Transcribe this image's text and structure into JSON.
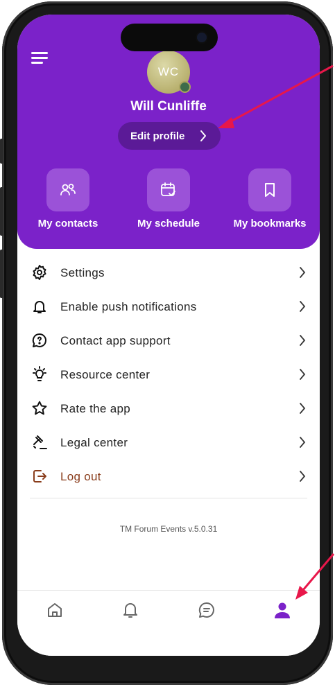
{
  "profile": {
    "initials": "WC",
    "name": "Will Cunliffe",
    "edit_label": "Edit profile"
  },
  "quick_actions": [
    {
      "label": "My contacts",
      "icon": "contacts-icon"
    },
    {
      "label": "My schedule",
      "icon": "calendar-check-icon"
    },
    {
      "label": "My bookmarks",
      "icon": "bookmark-icon"
    }
  ],
  "menu": [
    {
      "label": "Settings",
      "icon": "gear-icon"
    },
    {
      "label": "Enable push notifications",
      "icon": "bell-icon"
    },
    {
      "label": "Contact app support",
      "icon": "help-chat-icon"
    },
    {
      "label": "Resource center",
      "icon": "lightbulb-icon"
    },
    {
      "label": "Rate the app",
      "icon": "star-icon"
    },
    {
      "label": "Legal center",
      "icon": "gavel-icon"
    },
    {
      "label": "Log out",
      "icon": "logout-icon"
    }
  ],
  "version": "TM Forum Events v.5.0.31",
  "tabs": [
    {
      "name": "home",
      "icon": "home-icon",
      "active": false
    },
    {
      "name": "notifications",
      "icon": "bell-icon",
      "active": false
    },
    {
      "name": "messages",
      "icon": "chat-icon",
      "active": false
    },
    {
      "name": "profile",
      "icon": "person-icon",
      "active": true
    }
  ],
  "colors": {
    "header": "#7B22C9",
    "active_tab": "#7B22C9",
    "annotation_arrow": "#E8174A",
    "logout": "#8a3d1c"
  }
}
